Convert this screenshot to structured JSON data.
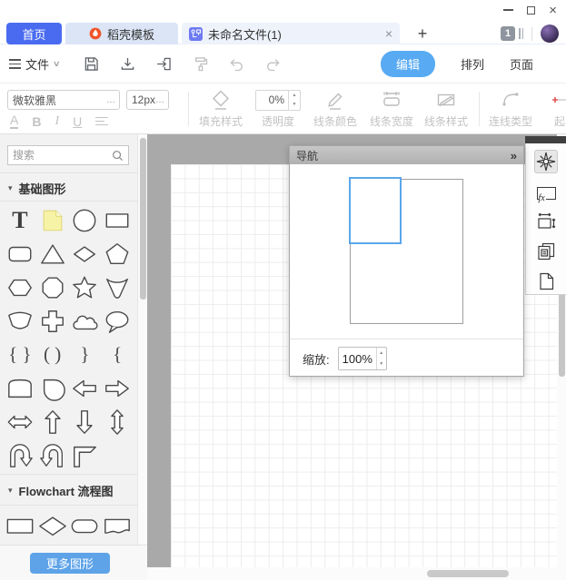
{
  "glyphs": {
    "plus": "+",
    "close": "×",
    "double_chevron": "»",
    "spin_up": "▲",
    "spin_down": "▼",
    "ellipsis": "…",
    "menu_caret": "∨",
    "section_arrow": "▾"
  },
  "tab_bar": {
    "home": "首页",
    "templates": "稻壳模板",
    "document": "未命名文件(1)",
    "window_count": "1"
  },
  "toolbar": {
    "file_menu": "文件",
    "edit_button": "编辑",
    "arrange_button": "排列",
    "page_button": "页面",
    "icons": [
      "save",
      "download",
      "export",
      "format-painter",
      "undo",
      "redo"
    ]
  },
  "format_bar": {
    "font_family": "微软雅黑",
    "font_size": "12px",
    "font_color": "A",
    "bold": "B",
    "italic": "I",
    "underline": "U",
    "fill_style": "填充样式",
    "opacity": "透明度",
    "opacity_value": "0%",
    "line_color": "线条颜色",
    "line_width": "线条宽度",
    "line_style": "线条样式",
    "connector_type": "连线类型",
    "start_point": "起点"
  },
  "sidebar": {
    "search_placeholder": "搜索",
    "section_basic": "基础图形",
    "section_flowchart": "Flowchart 流程图",
    "more_shapes_button": "更多图形",
    "text_glyph": "T",
    "brace_shapes": [
      "{ }",
      "( )",
      "}",
      "{"
    ],
    "basic_shapes": [
      "text",
      "sticky-note",
      "ellipse",
      "rectangle",
      "rounded-rectangle",
      "triangle",
      "diamond",
      "pentagon",
      "hexagon",
      "octagon",
      "star",
      "cone",
      "arc-trapezoid",
      "cross",
      "cloud",
      "callout",
      "brace-pair",
      "parenthesis-pair",
      "right-brace",
      "left-brace",
      "arch",
      "teardrop",
      "left-arrow",
      "right-arrow",
      "left-right-arrow",
      "up-arrow",
      "down-arrow",
      "up-down-arrow",
      "u-turn-arrow",
      "u-turn-arrow-alt",
      "corner-shape"
    ],
    "flowchart_shapes": [
      "process",
      "decision",
      "terminator",
      "document"
    ]
  },
  "navigation_panel": {
    "title": "导航",
    "zoom_label": "缩放:",
    "zoom_value": "100%"
  },
  "right_panel": {
    "icons": [
      "navigation-compass",
      "function-fx",
      "page-size",
      "outline-copy",
      "new-page"
    ],
    "fx_label": "fx"
  },
  "colors": {
    "home_tab": "#4a6bf0",
    "edit_button": "#58aaf2",
    "more_shapes_button": "#5ea3e8",
    "viewport_border": "#5ba7ea",
    "sticky_note": "#f7f3a6",
    "flame_icon": "#f0552a",
    "doc_tab_icon": "#6d7bf2"
  }
}
